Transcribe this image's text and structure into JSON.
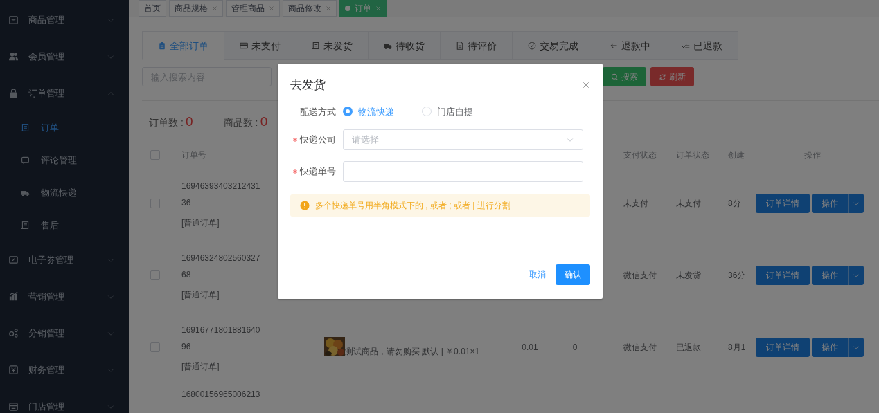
{
  "sidebar": {
    "items": [
      {
        "label": "商品管理",
        "expanded": false
      },
      {
        "label": "会员管理",
        "expanded": false
      },
      {
        "label": "订单管理",
        "expanded": true,
        "children": [
          {
            "label": "订单",
            "selected": true
          },
          {
            "label": "评论管理",
            "selected": false
          },
          {
            "label": "物流快递",
            "selected": false
          },
          {
            "label": "售后",
            "selected": false
          }
        ]
      },
      {
        "label": "电子券管理",
        "expanded": false
      },
      {
        "label": "营销管理",
        "expanded": false
      },
      {
        "label": "分销管理",
        "expanded": false
      },
      {
        "label": "财务管理",
        "expanded": false
      },
      {
        "label": "门店管理",
        "expanded": false
      }
    ]
  },
  "tag_bar": {
    "tags": [
      {
        "label": "首页",
        "closable": false,
        "selected": false
      },
      {
        "label": "商品规格",
        "closable": true,
        "selected": false
      },
      {
        "label": "管理商品",
        "closable": true,
        "selected": false
      },
      {
        "label": "商品修改",
        "closable": true,
        "selected": false
      },
      {
        "label": "订单",
        "closable": true,
        "selected": true
      }
    ]
  },
  "order_tabs": [
    {
      "label": "全部订单",
      "selected": true
    },
    {
      "label": "未支付",
      "selected": false
    },
    {
      "label": "未发货",
      "selected": false
    },
    {
      "label": "待收货",
      "selected": false
    },
    {
      "label": "待评价",
      "selected": false
    },
    {
      "label": "交易完成",
      "selected": false
    },
    {
      "label": "退款中",
      "selected": false
    },
    {
      "label": "已退款",
      "selected": false
    }
  ],
  "search": {
    "placeholder": "输入搜索内容",
    "buttons": [
      {
        "kind": "search",
        "label": "搜索"
      },
      {
        "kind": "refresh",
        "label": "刷新"
      }
    ]
  },
  "counts": [
    {
      "label": "订单数 :",
      "value": "0"
    },
    {
      "label": "商品数 :",
      "value": "0"
    }
  ],
  "table": {
    "select_all": {
      "checked": false
    },
    "header": {
      "order_no": "订单号",
      "payment": "支付状态",
      "status": "订单状态",
      "created": "创建",
      "actions": "操作"
    },
    "rows": [
      {
        "checked": false,
        "order_no": "1694639340321243136",
        "type": "[普通订单]",
        "payment": "未支付",
        "status": "未支付",
        "created": "8分",
        "actions": [
          "订单详情",
          "操作"
        ]
      },
      {
        "checked": false,
        "order_no": "1694632480256032768",
        "type": "[普通订单]",
        "payment": "微信支付",
        "status": "未发货",
        "created": "36分",
        "actions": [
          "订单详情",
          "操作"
        ]
      },
      {
        "checked": false,
        "order_no": "1691677180188164096",
        "type": "[普通订单]",
        "product": {
          "kind": "picture",
          "text": "测试商品，请勿购买 默认 | ￥0.01×1"
        },
        "amount": "0.01",
        "column_6": "0",
        "payment": "微信支付",
        "status": "已退款",
        "created": "8月1",
        "actions": [
          "订单详情",
          "操作"
        ]
      },
      {
        "order_no": "16800156965006213"
      }
    ]
  },
  "dialog": {
    "title": "去发货",
    "delivery": {
      "label": "配送方式",
      "options": [
        {
          "label": "物流快递",
          "selected": true
        },
        {
          "label": "门店自提",
          "selected": false
        }
      ]
    },
    "fields": [
      {
        "kind": "select",
        "label": "快递公司",
        "required": true,
        "placeholder": "请选择"
      },
      {
        "kind": "input",
        "label": "快递单号",
        "required": true
      }
    ],
    "alert": "多个快递单号用半角模式下的 , 或者 ; 或者 | 进行分割",
    "buttons": [
      {
        "kind": "text",
        "label": "取消"
      },
      {
        "kind": "primary",
        "label": "确认"
      }
    ]
  }
}
